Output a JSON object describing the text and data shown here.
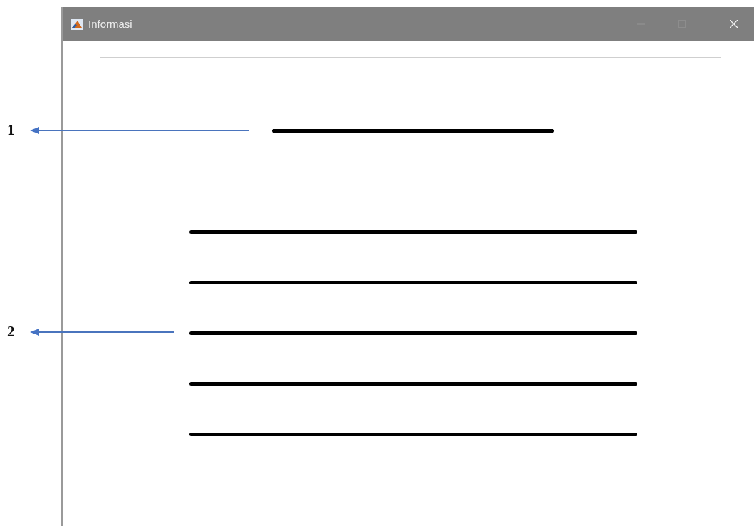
{
  "window": {
    "title": "Informasi",
    "controls": [
      {
        "kind": "minimize",
        "disabled": false
      },
      {
        "kind": "maximize",
        "disabled": true
      },
      {
        "kind": "close",
        "disabled": false
      }
    ]
  },
  "content_lines": [
    {
      "kind": "short"
    },
    {
      "kind": "long"
    },
    {
      "kind": "long"
    },
    {
      "kind": "long"
    },
    {
      "kind": "long"
    },
    {
      "kind": "long"
    }
  ],
  "annotations": [
    {
      "label": "1"
    },
    {
      "label": "2"
    }
  ]
}
